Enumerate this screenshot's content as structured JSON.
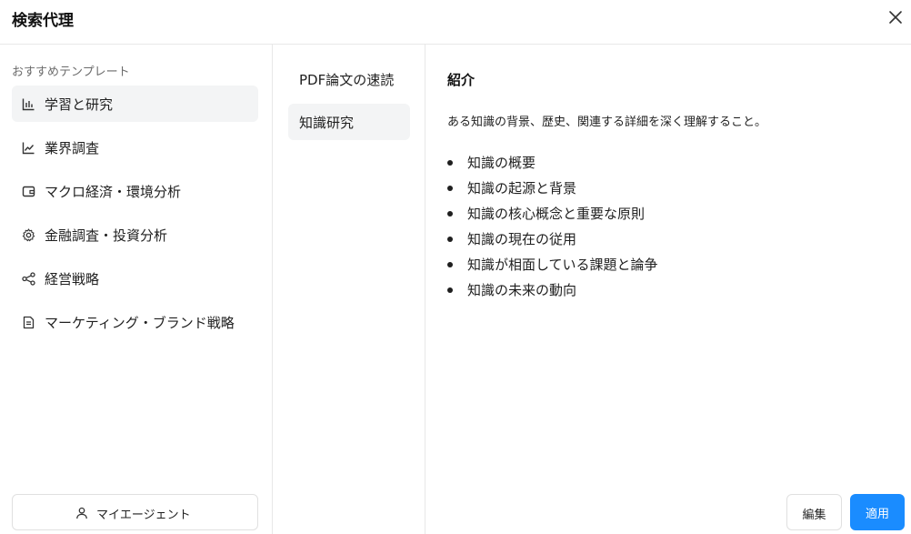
{
  "header": {
    "title": "検索代理",
    "close_icon": "close-icon"
  },
  "sidebar": {
    "section_label": "おすすめテンプレート",
    "items": [
      {
        "label": "学習と研究",
        "icon": "bar-chart-icon",
        "active": true
      },
      {
        "label": "業界調査",
        "icon": "line-chart-icon",
        "active": false
      },
      {
        "label": "マクロ経済・環境分析",
        "icon": "wallet-icon",
        "active": false
      },
      {
        "label": "金融調査・投資分析",
        "icon": "gear-icon",
        "active": false
      },
      {
        "label": "経営戦略",
        "icon": "share-icon",
        "active": false
      },
      {
        "label": "マーケティング・ブランド戦略",
        "icon": "document-icon",
        "active": false
      }
    ],
    "my_agent_label": "マイエージェント",
    "my_agent_icon": "user-icon"
  },
  "templates": {
    "items": [
      {
        "label": "PDF論文の速読",
        "active": false
      },
      {
        "label": "知識研究",
        "active": true
      }
    ]
  },
  "detail": {
    "heading": "紹介",
    "description": "ある知識の背景、歴史、関連する詳細を深く理解すること。",
    "bullets": [
      "知識の概要",
      "知識の起源と背景",
      "知識の核心概念と重要な原則",
      "知識の現在の従用",
      "知識が相面している課題と論争",
      "知識の未来の動向"
    ]
  },
  "actions": {
    "edit_label": "編集",
    "apply_label": "適用"
  },
  "colors": {
    "accent": "#1a8cff",
    "active_bg": "#f3f4f5",
    "border": "#e8e8e8"
  }
}
